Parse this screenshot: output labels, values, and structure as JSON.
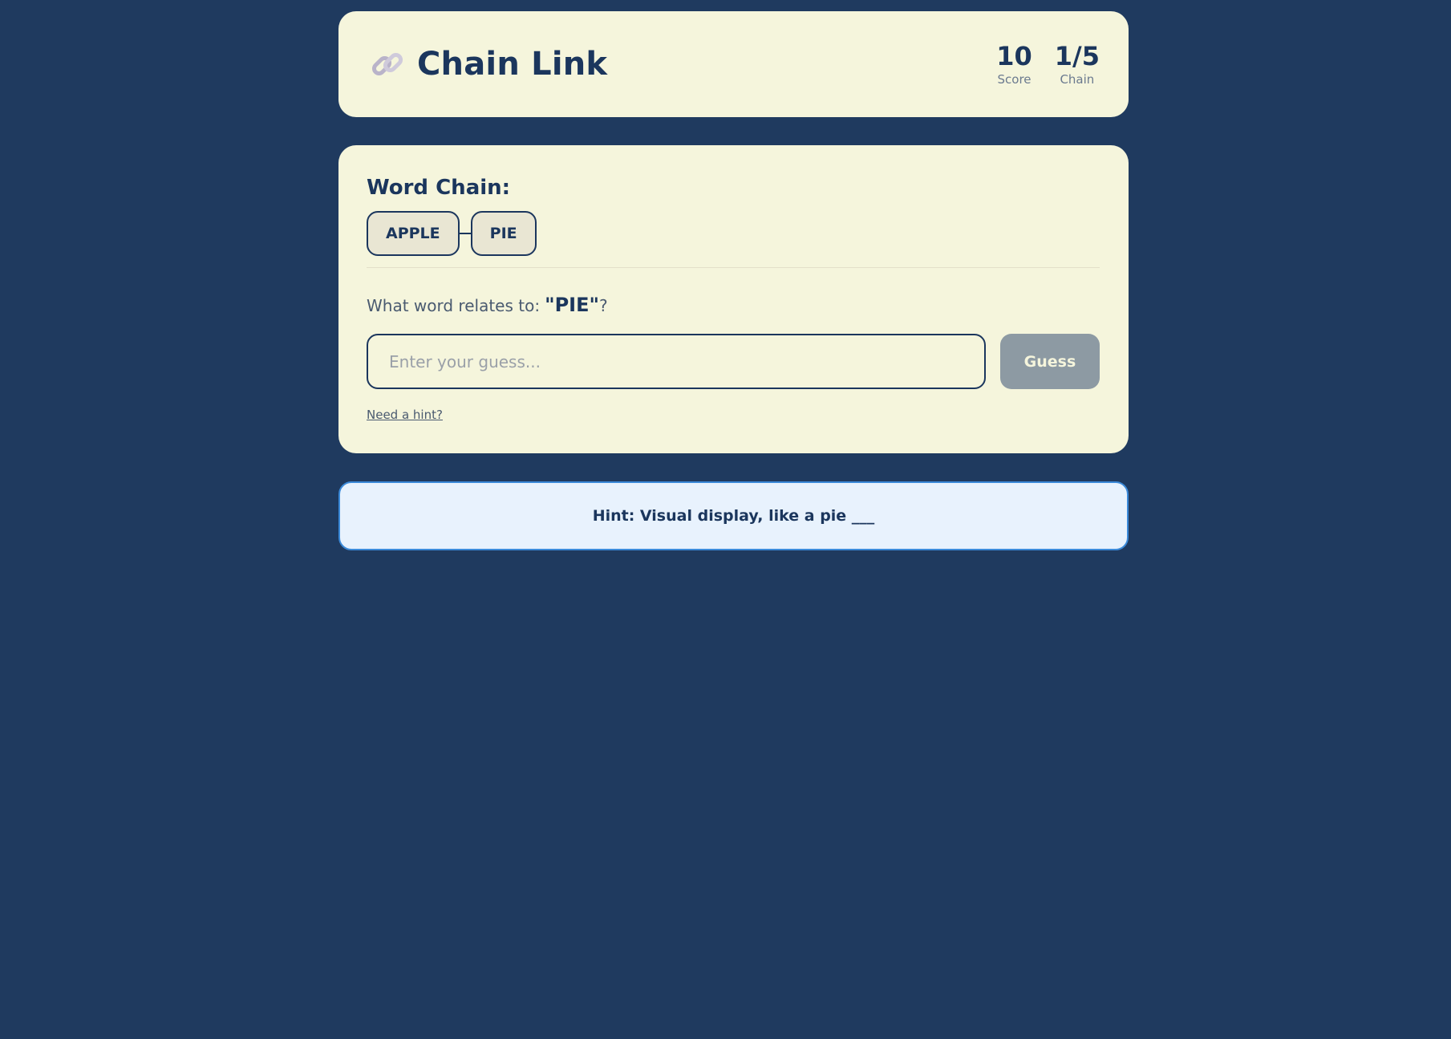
{
  "header": {
    "icon": "link-icon",
    "title": "Chain Link",
    "stats": [
      {
        "value": "10",
        "label": "Score"
      },
      {
        "value": "1/5",
        "label": "Chain"
      }
    ]
  },
  "game": {
    "chain_label": "Word Chain:",
    "chain_words": [
      "APPLE",
      "PIE"
    ],
    "prompt_text": "What word relates to:",
    "prompt_word": "\"PIE\"",
    "prompt_end": "?",
    "guess_placeholder": "Enter your guess...",
    "guess_value": "",
    "guess_button": "Guess",
    "hint_link": "Need a hint?"
  },
  "hint": {
    "text": "Hint: Visual display, like a pie ___"
  },
  "colors": {
    "background": "#1f3a5f",
    "card": "#f5f5dc",
    "primary": "#1b365d",
    "button_disabled": "#8d9aa3",
    "hint_bg": "#e8f2fd",
    "hint_border": "#3b8ad9"
  }
}
